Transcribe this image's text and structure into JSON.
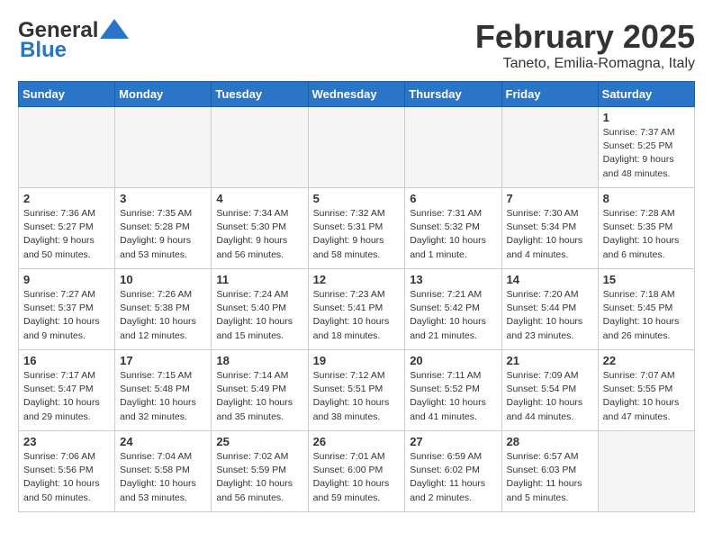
{
  "header": {
    "logo_general": "General",
    "logo_blue": "Blue",
    "month_title": "February 2025",
    "location": "Taneto, Emilia-Romagna, Italy"
  },
  "weekdays": [
    "Sunday",
    "Monday",
    "Tuesday",
    "Wednesday",
    "Thursday",
    "Friday",
    "Saturday"
  ],
  "weeks": [
    [
      {
        "day": "",
        "info": ""
      },
      {
        "day": "",
        "info": ""
      },
      {
        "day": "",
        "info": ""
      },
      {
        "day": "",
        "info": ""
      },
      {
        "day": "",
        "info": ""
      },
      {
        "day": "",
        "info": ""
      },
      {
        "day": "1",
        "info": "Sunrise: 7:37 AM\nSunset: 5:25 PM\nDaylight: 9 hours and 48 minutes."
      }
    ],
    [
      {
        "day": "2",
        "info": "Sunrise: 7:36 AM\nSunset: 5:27 PM\nDaylight: 9 hours and 50 minutes."
      },
      {
        "day": "3",
        "info": "Sunrise: 7:35 AM\nSunset: 5:28 PM\nDaylight: 9 hours and 53 minutes."
      },
      {
        "day": "4",
        "info": "Sunrise: 7:34 AM\nSunset: 5:30 PM\nDaylight: 9 hours and 56 minutes."
      },
      {
        "day": "5",
        "info": "Sunrise: 7:32 AM\nSunset: 5:31 PM\nDaylight: 9 hours and 58 minutes."
      },
      {
        "day": "6",
        "info": "Sunrise: 7:31 AM\nSunset: 5:32 PM\nDaylight: 10 hours and 1 minute."
      },
      {
        "day": "7",
        "info": "Sunrise: 7:30 AM\nSunset: 5:34 PM\nDaylight: 10 hours and 4 minutes."
      },
      {
        "day": "8",
        "info": "Sunrise: 7:28 AM\nSunset: 5:35 PM\nDaylight: 10 hours and 6 minutes."
      }
    ],
    [
      {
        "day": "9",
        "info": "Sunrise: 7:27 AM\nSunset: 5:37 PM\nDaylight: 10 hours and 9 minutes."
      },
      {
        "day": "10",
        "info": "Sunrise: 7:26 AM\nSunset: 5:38 PM\nDaylight: 10 hours and 12 minutes."
      },
      {
        "day": "11",
        "info": "Sunrise: 7:24 AM\nSunset: 5:40 PM\nDaylight: 10 hours and 15 minutes."
      },
      {
        "day": "12",
        "info": "Sunrise: 7:23 AM\nSunset: 5:41 PM\nDaylight: 10 hours and 18 minutes."
      },
      {
        "day": "13",
        "info": "Sunrise: 7:21 AM\nSunset: 5:42 PM\nDaylight: 10 hours and 21 minutes."
      },
      {
        "day": "14",
        "info": "Sunrise: 7:20 AM\nSunset: 5:44 PM\nDaylight: 10 hours and 23 minutes."
      },
      {
        "day": "15",
        "info": "Sunrise: 7:18 AM\nSunset: 5:45 PM\nDaylight: 10 hours and 26 minutes."
      }
    ],
    [
      {
        "day": "16",
        "info": "Sunrise: 7:17 AM\nSunset: 5:47 PM\nDaylight: 10 hours and 29 minutes."
      },
      {
        "day": "17",
        "info": "Sunrise: 7:15 AM\nSunset: 5:48 PM\nDaylight: 10 hours and 32 minutes."
      },
      {
        "day": "18",
        "info": "Sunrise: 7:14 AM\nSunset: 5:49 PM\nDaylight: 10 hours and 35 minutes."
      },
      {
        "day": "19",
        "info": "Sunrise: 7:12 AM\nSunset: 5:51 PM\nDaylight: 10 hours and 38 minutes."
      },
      {
        "day": "20",
        "info": "Sunrise: 7:11 AM\nSunset: 5:52 PM\nDaylight: 10 hours and 41 minutes."
      },
      {
        "day": "21",
        "info": "Sunrise: 7:09 AM\nSunset: 5:54 PM\nDaylight: 10 hours and 44 minutes."
      },
      {
        "day": "22",
        "info": "Sunrise: 7:07 AM\nSunset: 5:55 PM\nDaylight: 10 hours and 47 minutes."
      }
    ],
    [
      {
        "day": "23",
        "info": "Sunrise: 7:06 AM\nSunset: 5:56 PM\nDaylight: 10 hours and 50 minutes."
      },
      {
        "day": "24",
        "info": "Sunrise: 7:04 AM\nSunset: 5:58 PM\nDaylight: 10 hours and 53 minutes."
      },
      {
        "day": "25",
        "info": "Sunrise: 7:02 AM\nSunset: 5:59 PM\nDaylight: 10 hours and 56 minutes."
      },
      {
        "day": "26",
        "info": "Sunrise: 7:01 AM\nSunset: 6:00 PM\nDaylight: 10 hours and 59 minutes."
      },
      {
        "day": "27",
        "info": "Sunrise: 6:59 AM\nSunset: 6:02 PM\nDaylight: 11 hours and 2 minutes."
      },
      {
        "day": "28",
        "info": "Sunrise: 6:57 AM\nSunset: 6:03 PM\nDaylight: 11 hours and 5 minutes."
      },
      {
        "day": "",
        "info": ""
      }
    ]
  ]
}
